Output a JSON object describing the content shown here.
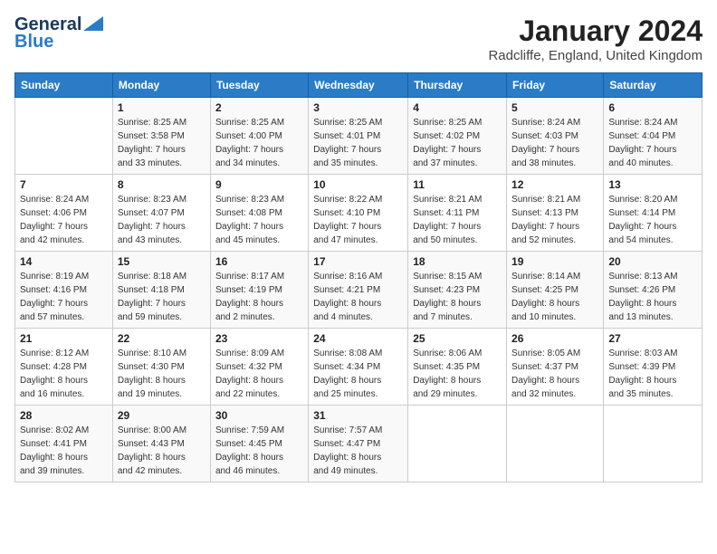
{
  "logo": {
    "line1": "General",
    "line2": "Blue"
  },
  "title": "January 2024",
  "subtitle": "Radcliffe, England, United Kingdom",
  "days_of_week": [
    "Sunday",
    "Monday",
    "Tuesday",
    "Wednesday",
    "Thursday",
    "Friday",
    "Saturday"
  ],
  "weeks": [
    [
      {
        "day": "",
        "info": ""
      },
      {
        "day": "1",
        "info": "Sunrise: 8:25 AM\nSunset: 3:58 PM\nDaylight: 7 hours\nand 33 minutes."
      },
      {
        "day": "2",
        "info": "Sunrise: 8:25 AM\nSunset: 4:00 PM\nDaylight: 7 hours\nand 34 minutes."
      },
      {
        "day": "3",
        "info": "Sunrise: 8:25 AM\nSunset: 4:01 PM\nDaylight: 7 hours\nand 35 minutes."
      },
      {
        "day": "4",
        "info": "Sunrise: 8:25 AM\nSunset: 4:02 PM\nDaylight: 7 hours\nand 37 minutes."
      },
      {
        "day": "5",
        "info": "Sunrise: 8:24 AM\nSunset: 4:03 PM\nDaylight: 7 hours\nand 38 minutes."
      },
      {
        "day": "6",
        "info": "Sunrise: 8:24 AM\nSunset: 4:04 PM\nDaylight: 7 hours\nand 40 minutes."
      }
    ],
    [
      {
        "day": "7",
        "info": "Sunrise: 8:24 AM\nSunset: 4:06 PM\nDaylight: 7 hours\nand 42 minutes."
      },
      {
        "day": "8",
        "info": "Sunrise: 8:23 AM\nSunset: 4:07 PM\nDaylight: 7 hours\nand 43 minutes."
      },
      {
        "day": "9",
        "info": "Sunrise: 8:23 AM\nSunset: 4:08 PM\nDaylight: 7 hours\nand 45 minutes."
      },
      {
        "day": "10",
        "info": "Sunrise: 8:22 AM\nSunset: 4:10 PM\nDaylight: 7 hours\nand 47 minutes."
      },
      {
        "day": "11",
        "info": "Sunrise: 8:21 AM\nSunset: 4:11 PM\nDaylight: 7 hours\nand 50 minutes."
      },
      {
        "day": "12",
        "info": "Sunrise: 8:21 AM\nSunset: 4:13 PM\nDaylight: 7 hours\nand 52 minutes."
      },
      {
        "day": "13",
        "info": "Sunrise: 8:20 AM\nSunset: 4:14 PM\nDaylight: 7 hours\nand 54 minutes."
      }
    ],
    [
      {
        "day": "14",
        "info": "Sunrise: 8:19 AM\nSunset: 4:16 PM\nDaylight: 7 hours\nand 57 minutes."
      },
      {
        "day": "15",
        "info": "Sunrise: 8:18 AM\nSunset: 4:18 PM\nDaylight: 7 hours\nand 59 minutes."
      },
      {
        "day": "16",
        "info": "Sunrise: 8:17 AM\nSunset: 4:19 PM\nDaylight: 8 hours\nand 2 minutes."
      },
      {
        "day": "17",
        "info": "Sunrise: 8:16 AM\nSunset: 4:21 PM\nDaylight: 8 hours\nand 4 minutes."
      },
      {
        "day": "18",
        "info": "Sunrise: 8:15 AM\nSunset: 4:23 PM\nDaylight: 8 hours\nand 7 minutes."
      },
      {
        "day": "19",
        "info": "Sunrise: 8:14 AM\nSunset: 4:25 PM\nDaylight: 8 hours\nand 10 minutes."
      },
      {
        "day": "20",
        "info": "Sunrise: 8:13 AM\nSunset: 4:26 PM\nDaylight: 8 hours\nand 13 minutes."
      }
    ],
    [
      {
        "day": "21",
        "info": "Sunrise: 8:12 AM\nSunset: 4:28 PM\nDaylight: 8 hours\nand 16 minutes."
      },
      {
        "day": "22",
        "info": "Sunrise: 8:10 AM\nSunset: 4:30 PM\nDaylight: 8 hours\nand 19 minutes."
      },
      {
        "day": "23",
        "info": "Sunrise: 8:09 AM\nSunset: 4:32 PM\nDaylight: 8 hours\nand 22 minutes."
      },
      {
        "day": "24",
        "info": "Sunrise: 8:08 AM\nSunset: 4:34 PM\nDaylight: 8 hours\nand 25 minutes."
      },
      {
        "day": "25",
        "info": "Sunrise: 8:06 AM\nSunset: 4:35 PM\nDaylight: 8 hours\nand 29 minutes."
      },
      {
        "day": "26",
        "info": "Sunrise: 8:05 AM\nSunset: 4:37 PM\nDaylight: 8 hours\nand 32 minutes."
      },
      {
        "day": "27",
        "info": "Sunrise: 8:03 AM\nSunset: 4:39 PM\nDaylight: 8 hours\nand 35 minutes."
      }
    ],
    [
      {
        "day": "28",
        "info": "Sunrise: 8:02 AM\nSunset: 4:41 PM\nDaylight: 8 hours\nand 39 minutes."
      },
      {
        "day": "29",
        "info": "Sunrise: 8:00 AM\nSunset: 4:43 PM\nDaylight: 8 hours\nand 42 minutes."
      },
      {
        "day": "30",
        "info": "Sunrise: 7:59 AM\nSunset: 4:45 PM\nDaylight: 8 hours\nand 46 minutes."
      },
      {
        "day": "31",
        "info": "Sunrise: 7:57 AM\nSunset: 4:47 PM\nDaylight: 8 hours\nand 49 minutes."
      },
      {
        "day": "",
        "info": ""
      },
      {
        "day": "",
        "info": ""
      },
      {
        "day": "",
        "info": ""
      }
    ]
  ]
}
